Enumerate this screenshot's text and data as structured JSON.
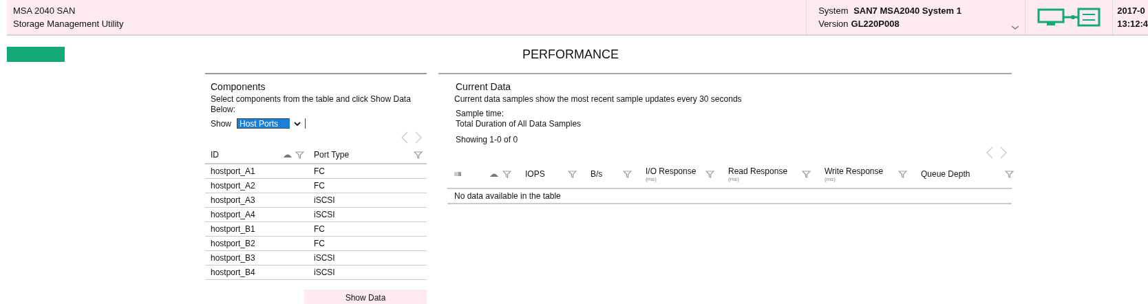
{
  "header": {
    "product": "MSA 2040 SAN",
    "subtitle": "Storage Management Utility",
    "system_label": "System",
    "system_value": "SAN7 MSA2040 System 1",
    "version_label": "Version",
    "version_value": "GL220P008",
    "date": "2017-0",
    "time": "13:12:4"
  },
  "page_title": "PERFORMANCE",
  "components": {
    "title": "Components",
    "instructions": "Select components from the table and click Show Data Below:",
    "show_label": "Show",
    "show_value": "Host Ports",
    "columns": [
      {
        "label": "ID",
        "sorted": true
      },
      {
        "label": "Port Type",
        "sorted": false
      }
    ],
    "rows": [
      {
        "id": "hostport_A1",
        "port_type": "FC"
      },
      {
        "id": "hostport_A2",
        "port_type": "FC"
      },
      {
        "id": "hostport_A3",
        "port_type": "iSCSI"
      },
      {
        "id": "hostport_A4",
        "port_type": "iSCSI"
      },
      {
        "id": "hostport_B1",
        "port_type": "FC"
      },
      {
        "id": "hostport_B2",
        "port_type": "FC"
      },
      {
        "id": "hostport_B3",
        "port_type": "iSCSI"
      },
      {
        "id": "hostport_B4",
        "port_type": "iSCSI"
      }
    ],
    "button": "Show Data"
  },
  "current_data": {
    "title": "Current Data",
    "description": "Current data samples show the most recent sample updates every 30 seconds",
    "sample_time_label": "Sample time:",
    "duration_label": "Total Duration of All Data  Samples",
    "showing": "Showing 1-0 of 0",
    "columns": [
      {
        "kind": "icon",
        "sorted": true
      },
      {
        "kind": "text",
        "label": "IOPS",
        "sorted": false
      },
      {
        "kind": "text",
        "label": "B/s",
        "sorted": false
      },
      {
        "kind": "text",
        "label": "I/O Response",
        "unit": "(ms)",
        "sorted": false
      },
      {
        "kind": "text",
        "label": "Read Response",
        "unit": "(ms)",
        "sorted": false
      },
      {
        "kind": "text",
        "label": "Write Response",
        "unit": "(ms)",
        "sorted": false
      },
      {
        "kind": "text",
        "label": "Queue Depth",
        "sorted": false
      }
    ],
    "empty_message": "No data available in the table"
  }
}
